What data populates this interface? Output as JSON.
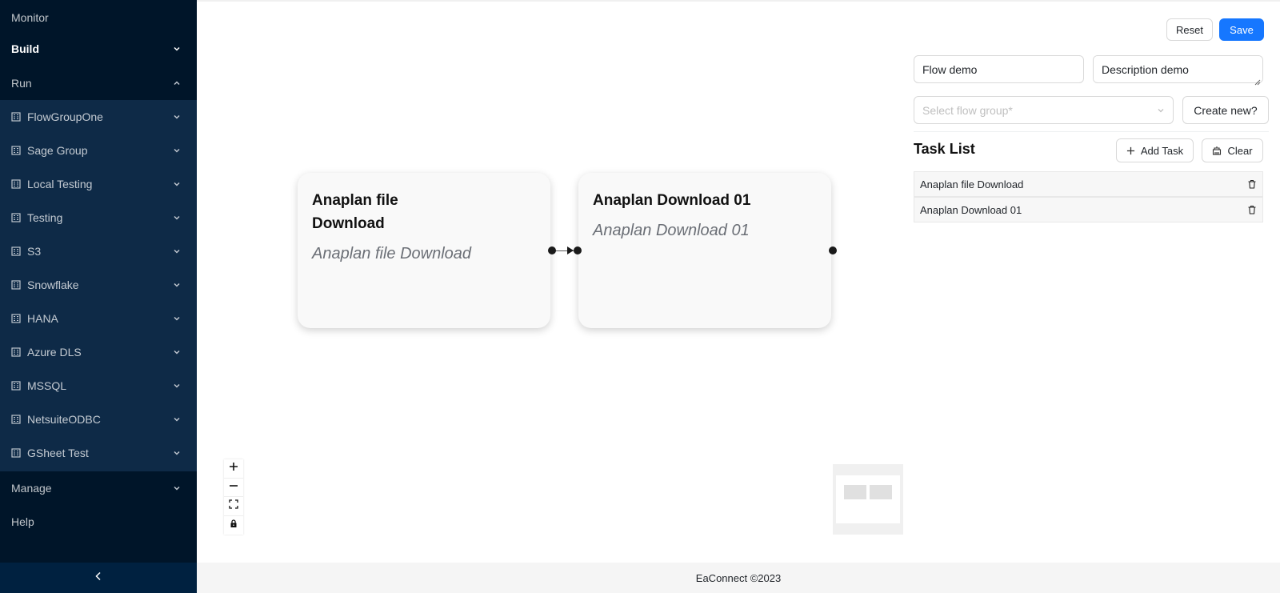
{
  "sidebar": {
    "items": {
      "monitor": "Monitor",
      "build": "Build",
      "run": "Run",
      "manage": "Manage",
      "help": "Help"
    },
    "run_groups": [
      "FlowGroupOne",
      "Sage Group",
      "Local Testing",
      "Testing",
      "S3",
      "Snowflake",
      "HANA",
      "Azure DLS",
      "MSSQL",
      "NetsuiteODBC",
      "GSheet Test"
    ],
    "collapse_icon": "chevron-left-icon"
  },
  "canvas": {
    "nodes": [
      {
        "title": "Anaplan file Download",
        "subtitle": "Anaplan file Download"
      },
      {
        "title": "Anaplan Download 01",
        "subtitle": "Anaplan Download 01"
      }
    ],
    "controls": {
      "zoom_in": "plus-icon",
      "zoom_out": "minus-icon",
      "fit_view": "fit-view-icon",
      "lock": "lock-icon"
    }
  },
  "panel": {
    "reset_label": "Reset",
    "save_label": "Save",
    "flow_name_value": "Flow demo",
    "description_value": "Description demo",
    "flow_group_placeholder": "Select flow group*",
    "create_new_label": "Create new?",
    "task_list_title": "Task List",
    "add_task_label": "Add Task",
    "clear_label": "Clear",
    "tasks": [
      "Anaplan file Download",
      "Anaplan Download 01"
    ]
  },
  "footer": {
    "text": "EaConnect ©2023"
  },
  "colors": {
    "sidebar_bg": "#001529",
    "submenu_bg": "#0e2a47",
    "primary": "#1677ff"
  }
}
